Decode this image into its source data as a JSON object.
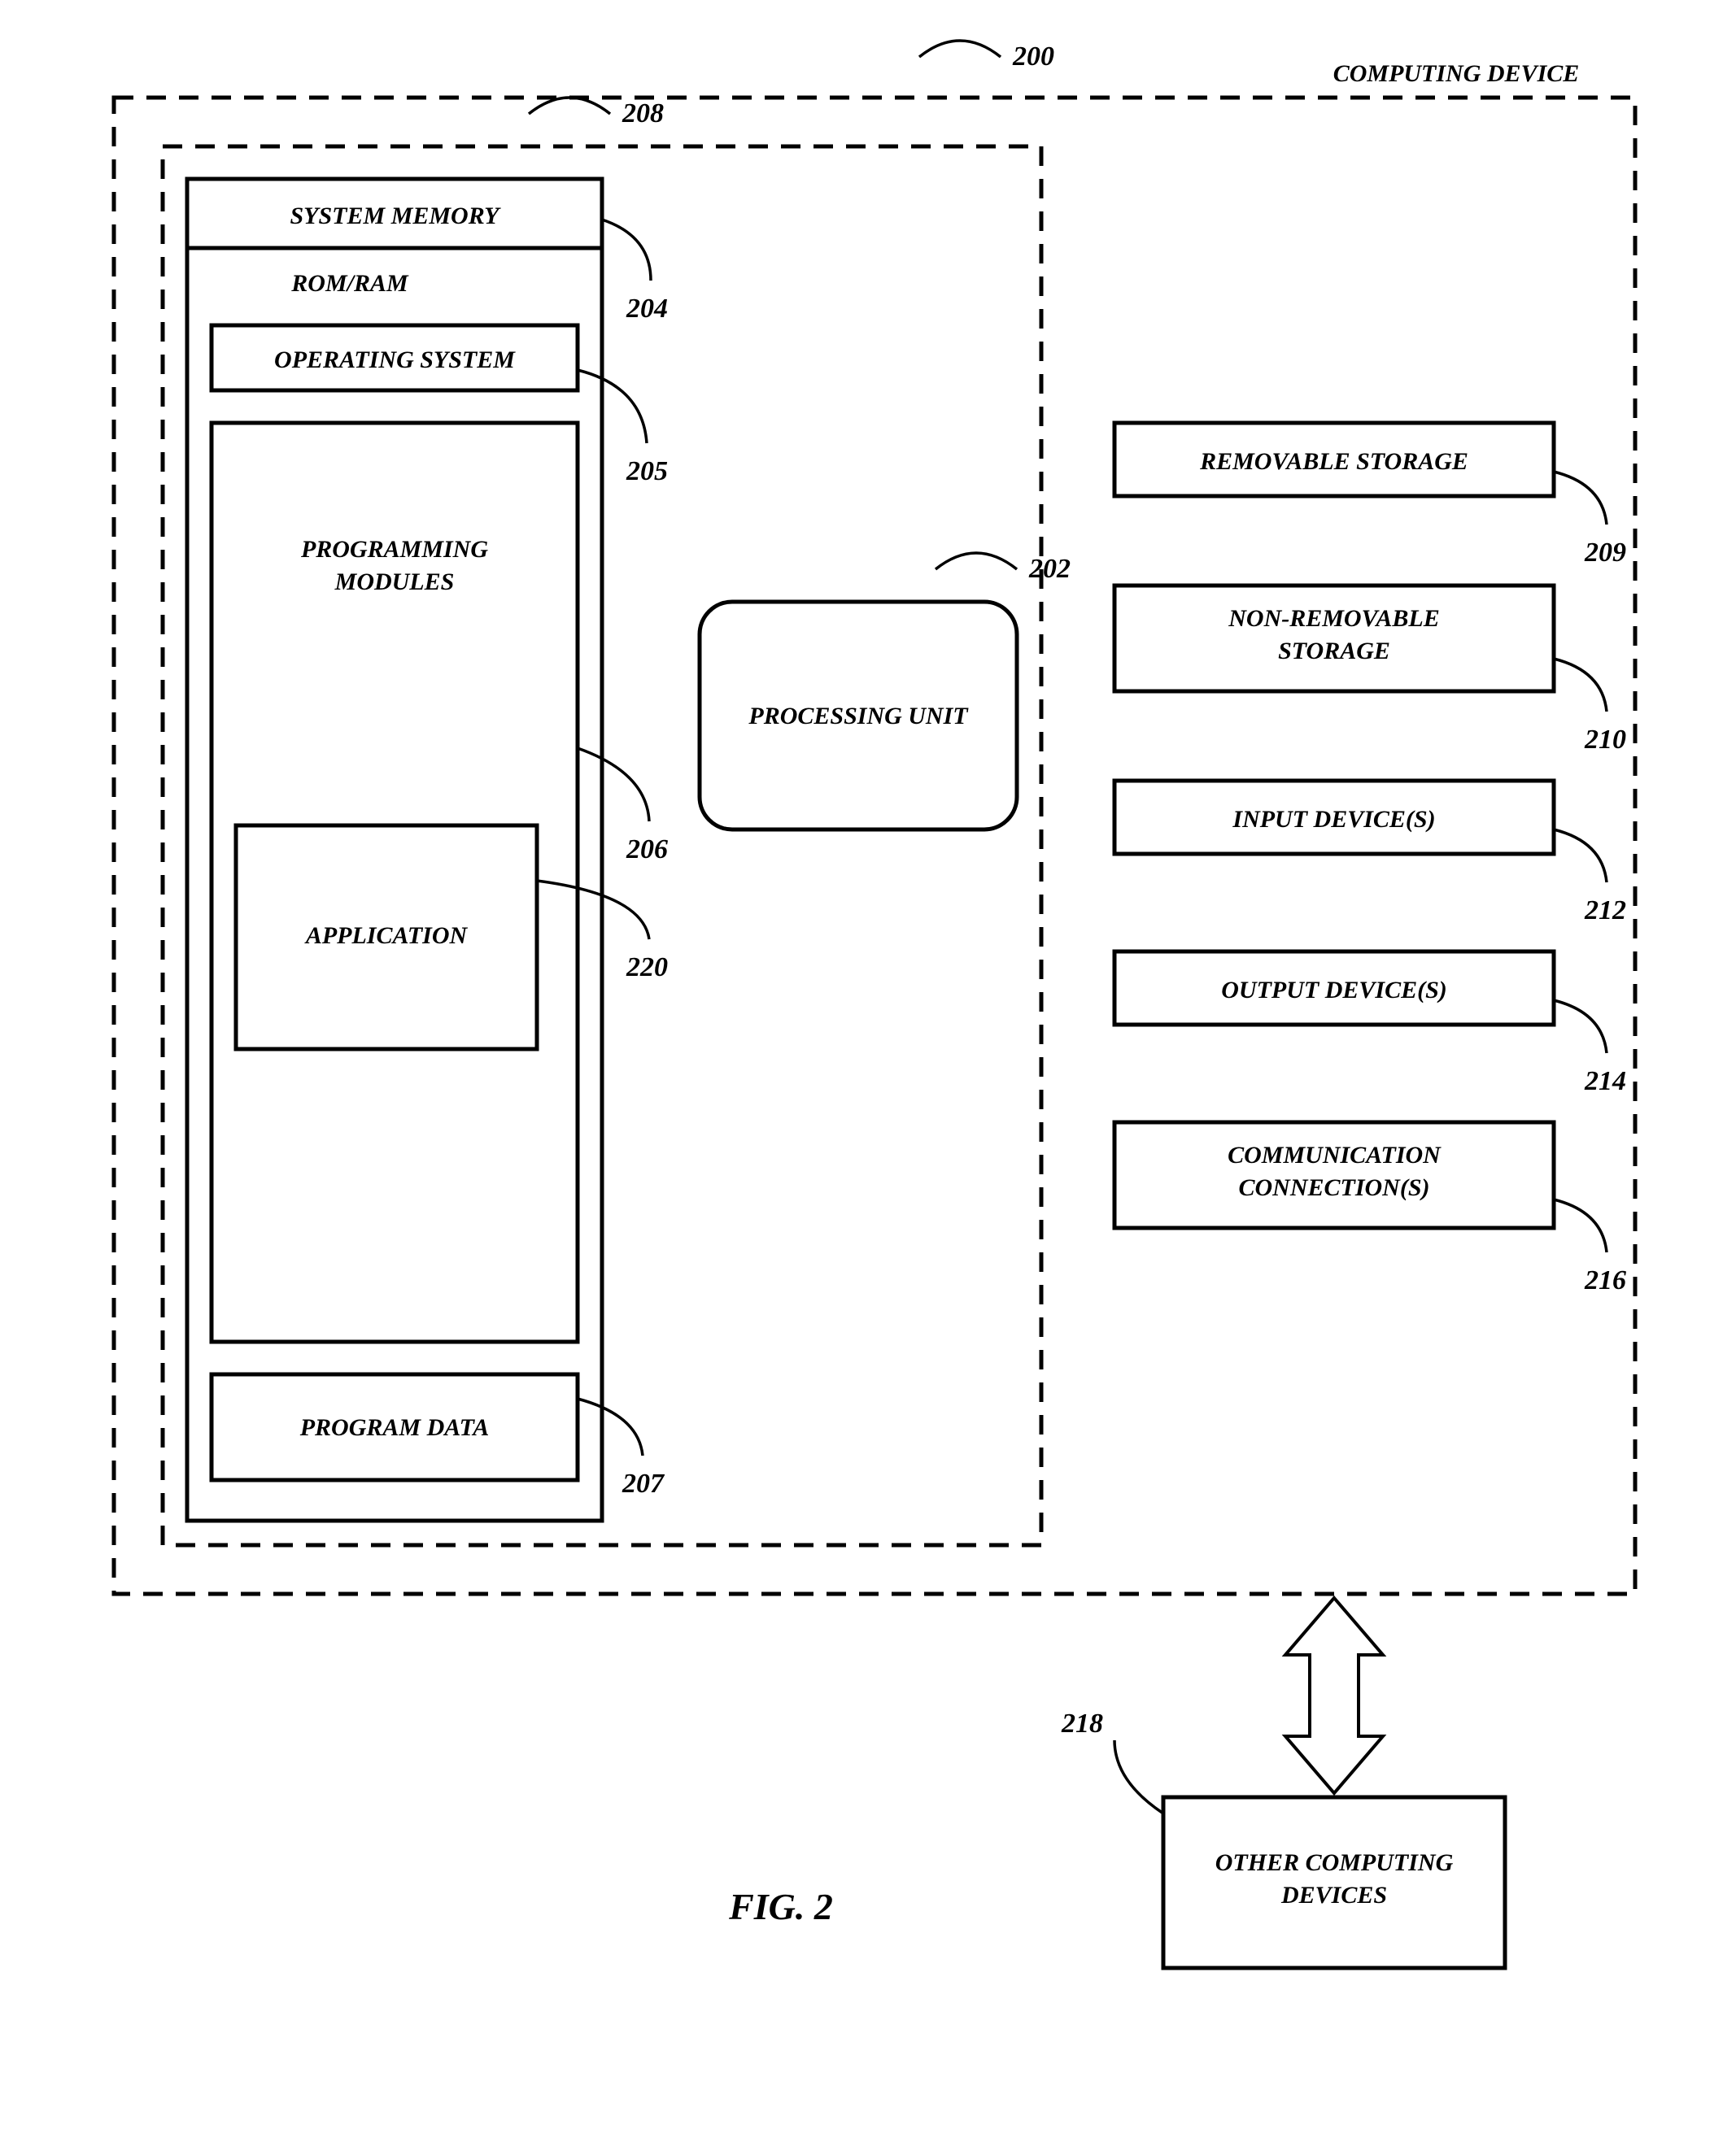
{
  "title": "COMPUTING DEVICE",
  "refs": {
    "device": "200",
    "inner": "208",
    "sysmem": "204",
    "os": "205",
    "progmod": "206",
    "app": "220",
    "progdata": "207",
    "punit": "202",
    "remstor": "209",
    "nremstor": "210",
    "input": "212",
    "output": "214",
    "comm": "216",
    "other": "218"
  },
  "labels": {
    "sysmem": "SYSTEM MEMORY",
    "romram": "ROM/RAM",
    "os": "OPERATING SYSTEM",
    "progmod1": "PROGRAMMING",
    "progmod2": "MODULES",
    "app": "APPLICATION",
    "progdata": "PROGRAM DATA",
    "punit": "PROCESSING UNIT",
    "remstor": "REMOVABLE STORAGE",
    "nremstor1": "NON-REMOVABLE",
    "nremstor2": "STORAGE",
    "input": "INPUT DEVICE(S)",
    "output": "OUTPUT DEVICE(S)",
    "comm1": "COMMUNICATION",
    "comm2": "CONNECTION(S)",
    "other1": "OTHER COMPUTING",
    "other2": "DEVICES"
  },
  "figure": "FIG. 2"
}
